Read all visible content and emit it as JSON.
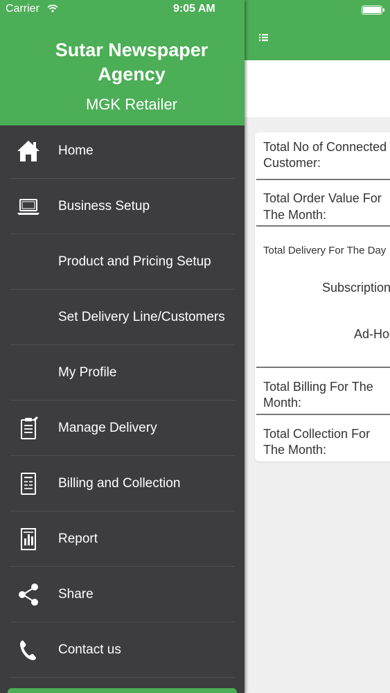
{
  "status_bar": {
    "carrier": "Carrier",
    "time": "9:05 AM"
  },
  "drawer": {
    "agency_name": "Sutar  Newspaper\nAgency",
    "role": "MGK Retailer",
    "items": [
      {
        "label": "Home",
        "icon": "home-icon"
      },
      {
        "label": "Business Setup",
        "icon": "laptop-icon"
      },
      {
        "label": "Product and Pricing Setup",
        "icon": ""
      },
      {
        "label": "Set Delivery Line/Customers",
        "icon": ""
      },
      {
        "label": "My Profile",
        "icon": ""
      },
      {
        "label": "Manage Delivery",
        "icon": "clipboard-icon"
      },
      {
        "label": "Billing and Collection",
        "icon": "bill-icon"
      },
      {
        "label": "Report",
        "icon": "report-icon"
      },
      {
        "label": "Share",
        "icon": "share-icon"
      },
      {
        "label": "Contact us",
        "icon": "phone-icon"
      }
    ]
  },
  "dashboard": {
    "connected_customer_label_1": "Total No of Connected",
    "connected_customer_label_2": "Customer:",
    "order_value_label_1": "Total Order Value For",
    "order_value_label_2": "The Month:",
    "delivery_day_label": "Total Delivery For The Day",
    "subscription_label": "Subscription",
    "adhoc_label": "Ad-Hoc",
    "billing_label_1": "Total Billing For The",
    "billing_label_2": "Month:",
    "collection_label_1": "Total Collection For",
    "collection_label_2": "The Month:"
  },
  "colors": {
    "accent": "#4cae56",
    "drawer_bg": "#3d3c3e",
    "content_bg": "#f0f0f0"
  }
}
